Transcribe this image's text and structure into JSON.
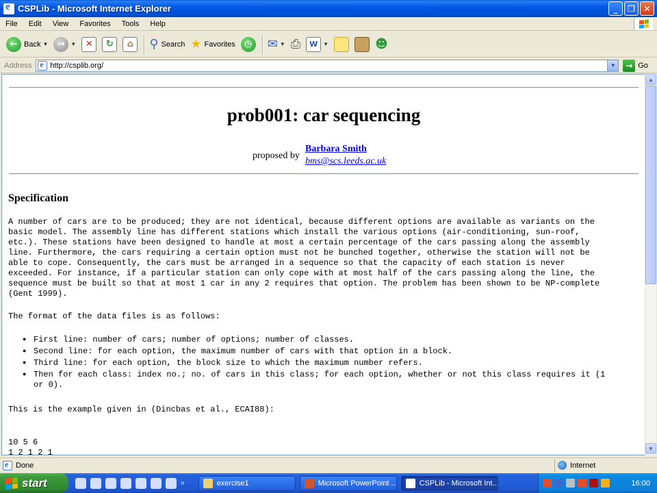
{
  "window": {
    "title": "CSPLib - Microsoft Internet Explorer"
  },
  "menu": [
    "File",
    "Edit",
    "View",
    "Favorites",
    "Tools",
    "Help"
  ],
  "toolbar": {
    "back_label": "Back",
    "search_label": "Search",
    "favorites_label": "Favorites"
  },
  "address": {
    "label": "Address",
    "url": "http://csplib.org/",
    "go_label": "Go"
  },
  "page": {
    "title": "prob001: car sequencing",
    "proposed_by": "proposed by",
    "author": "Barbara Smith",
    "email": "bms@scs.leeds.ac.uk",
    "spec_heading": "Specification",
    "spec_text": "A number of cars are to be produced; they are not identical, because different options are available as variants on the\nbasic model. The assembly line has different stations which install the various options (air-conditioning, sun-roof,\netc.). These stations have been designed to handle at most a certain percentage of the cars passing along the assembly\nline. Furthermore, the cars requiring a certain option must not be bunched together, otherwise the station will not be\nable to cope. Consequently, the cars must be arranged in a sequence so that the capacity of each station is never\nexceeded. For instance, if a particular station can only cope with at most half of the cars passing along the line, the\nsequence must be built so that at most 1 car in any 2 requires that option. The problem has been shown to be NP-complete\n(Gent 1999).",
    "format_intro": "The format of the data files is as follows:",
    "format_items": [
      "First line: number of cars; number of options; number of classes.",
      "Second line: for each option, the maximum number of cars with that option in a block.",
      "Third line: for each option, the block size to which the maximum number refers.",
      "Then for each class: index no.; no. of cars in this class; for each option, whether or not this class requires it (1\nor 0)."
    ],
    "example_intro": "This is the example given in (Dincbas et al., ECAI88):",
    "data_lines": [
      "10 5 6",
      "1 2 1 2 1"
    ]
  },
  "status": {
    "text": "Done",
    "zone": "Internet"
  },
  "taskbar": {
    "start_label": "start",
    "tasks": [
      "exercise1",
      "Microsoft PowerPoint ...",
      "CSPLib - Microsoft Int..."
    ],
    "clock": "16:00"
  }
}
